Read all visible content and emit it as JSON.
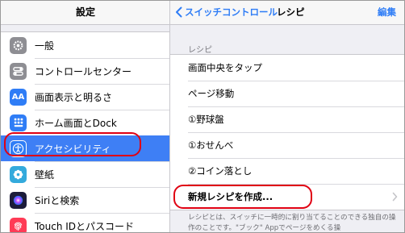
{
  "left": {
    "title": "設定",
    "items": [
      {
        "label": "一般",
        "icon": "gear-icon",
        "color": "#8e8e93"
      },
      {
        "label": "コントロールセンター",
        "icon": "toggles-icon",
        "color": "#8e8e93"
      },
      {
        "label": "画面表示と明るさ",
        "icon": "text-size-icon",
        "color": "#2f7df6"
      },
      {
        "label": "ホーム画面とDock",
        "icon": "home-grid-icon",
        "color": "#2f7df6"
      },
      {
        "label": "アクセシビリティ",
        "icon": "accessibility-icon",
        "color": "#2f7df6",
        "selected": true
      },
      {
        "label": "壁紙",
        "icon": "wallpaper-flower-icon",
        "color": "#34aadc"
      },
      {
        "label": "Siriと検索",
        "icon": "siri-icon",
        "color": "#1c1c3a"
      },
      {
        "label": "Touch IDとパスコード",
        "icon": "fingerprint-icon",
        "color": "#ff3b56"
      }
    ]
  },
  "right": {
    "back_label": "スイッチコントロール",
    "title": "レシピ",
    "edit_label": "編集",
    "section_header": "レシピ",
    "items": [
      {
        "label": "画面中央をタップ"
      },
      {
        "label": "ページ移動"
      },
      {
        "label": "①野球盤"
      },
      {
        "label": "①おせんべ"
      },
      {
        "label": "②コイン落とし"
      },
      {
        "label": "新規レシピを作成...",
        "chevron": true
      }
    ],
    "footer": "レシピとは、スイッチに一時的に割り当てることのできる独自の操作のことです。\"ブック\" Appでページをめくる操"
  },
  "colors": {
    "accent": "#2f7df6",
    "selection": "#3e7ff5",
    "highlight_ring": "#e00012"
  }
}
